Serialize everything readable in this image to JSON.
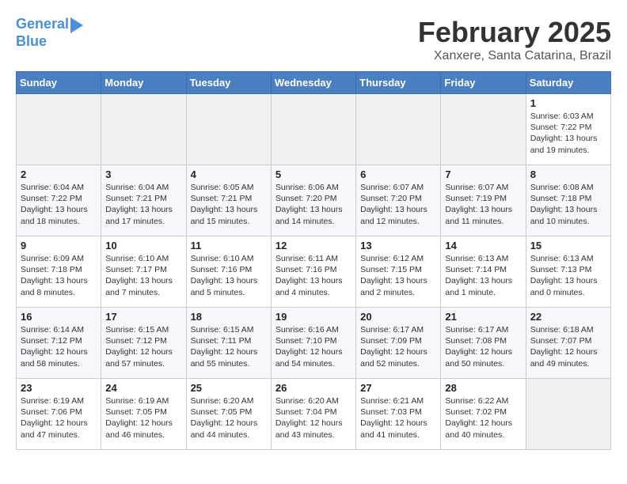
{
  "header": {
    "logo_line1": "General",
    "logo_line2": "Blue",
    "title": "February 2025",
    "subtitle": "Xanxere, Santa Catarina, Brazil"
  },
  "weekdays": [
    "Sunday",
    "Monday",
    "Tuesday",
    "Wednesday",
    "Thursday",
    "Friday",
    "Saturday"
  ],
  "weeks": [
    [
      {
        "day": "",
        "info": ""
      },
      {
        "day": "",
        "info": ""
      },
      {
        "day": "",
        "info": ""
      },
      {
        "day": "",
        "info": ""
      },
      {
        "day": "",
        "info": ""
      },
      {
        "day": "",
        "info": ""
      },
      {
        "day": "1",
        "info": "Sunrise: 6:03 AM\nSunset: 7:22 PM\nDaylight: 13 hours\nand 19 minutes."
      }
    ],
    [
      {
        "day": "2",
        "info": "Sunrise: 6:04 AM\nSunset: 7:22 PM\nDaylight: 13 hours\nand 18 minutes."
      },
      {
        "day": "3",
        "info": "Sunrise: 6:04 AM\nSunset: 7:21 PM\nDaylight: 13 hours\nand 17 minutes."
      },
      {
        "day": "4",
        "info": "Sunrise: 6:05 AM\nSunset: 7:21 PM\nDaylight: 13 hours\nand 15 minutes."
      },
      {
        "day": "5",
        "info": "Sunrise: 6:06 AM\nSunset: 7:20 PM\nDaylight: 13 hours\nand 14 minutes."
      },
      {
        "day": "6",
        "info": "Sunrise: 6:07 AM\nSunset: 7:20 PM\nDaylight: 13 hours\nand 12 minutes."
      },
      {
        "day": "7",
        "info": "Sunrise: 6:07 AM\nSunset: 7:19 PM\nDaylight: 13 hours\nand 11 minutes."
      },
      {
        "day": "8",
        "info": "Sunrise: 6:08 AM\nSunset: 7:18 PM\nDaylight: 13 hours\nand 10 minutes."
      }
    ],
    [
      {
        "day": "9",
        "info": "Sunrise: 6:09 AM\nSunset: 7:18 PM\nDaylight: 13 hours\nand 8 minutes."
      },
      {
        "day": "10",
        "info": "Sunrise: 6:10 AM\nSunset: 7:17 PM\nDaylight: 13 hours\nand 7 minutes."
      },
      {
        "day": "11",
        "info": "Sunrise: 6:10 AM\nSunset: 7:16 PM\nDaylight: 13 hours\nand 5 minutes."
      },
      {
        "day": "12",
        "info": "Sunrise: 6:11 AM\nSunset: 7:16 PM\nDaylight: 13 hours\nand 4 minutes."
      },
      {
        "day": "13",
        "info": "Sunrise: 6:12 AM\nSunset: 7:15 PM\nDaylight: 13 hours\nand 2 minutes."
      },
      {
        "day": "14",
        "info": "Sunrise: 6:13 AM\nSunset: 7:14 PM\nDaylight: 13 hours\nand 1 minute."
      },
      {
        "day": "15",
        "info": "Sunrise: 6:13 AM\nSunset: 7:13 PM\nDaylight: 13 hours\nand 0 minutes."
      }
    ],
    [
      {
        "day": "16",
        "info": "Sunrise: 6:14 AM\nSunset: 7:12 PM\nDaylight: 12 hours\nand 58 minutes."
      },
      {
        "day": "17",
        "info": "Sunrise: 6:15 AM\nSunset: 7:12 PM\nDaylight: 12 hours\nand 57 minutes."
      },
      {
        "day": "18",
        "info": "Sunrise: 6:15 AM\nSunset: 7:11 PM\nDaylight: 12 hours\nand 55 minutes."
      },
      {
        "day": "19",
        "info": "Sunrise: 6:16 AM\nSunset: 7:10 PM\nDaylight: 12 hours\nand 54 minutes."
      },
      {
        "day": "20",
        "info": "Sunrise: 6:17 AM\nSunset: 7:09 PM\nDaylight: 12 hours\nand 52 minutes."
      },
      {
        "day": "21",
        "info": "Sunrise: 6:17 AM\nSunset: 7:08 PM\nDaylight: 12 hours\nand 50 minutes."
      },
      {
        "day": "22",
        "info": "Sunrise: 6:18 AM\nSunset: 7:07 PM\nDaylight: 12 hours\nand 49 minutes."
      }
    ],
    [
      {
        "day": "23",
        "info": "Sunrise: 6:19 AM\nSunset: 7:06 PM\nDaylight: 12 hours\nand 47 minutes."
      },
      {
        "day": "24",
        "info": "Sunrise: 6:19 AM\nSunset: 7:05 PM\nDaylight: 12 hours\nand 46 minutes."
      },
      {
        "day": "25",
        "info": "Sunrise: 6:20 AM\nSunset: 7:05 PM\nDaylight: 12 hours\nand 44 minutes."
      },
      {
        "day": "26",
        "info": "Sunrise: 6:20 AM\nSunset: 7:04 PM\nDaylight: 12 hours\nand 43 minutes."
      },
      {
        "day": "27",
        "info": "Sunrise: 6:21 AM\nSunset: 7:03 PM\nDaylight: 12 hours\nand 41 minutes."
      },
      {
        "day": "28",
        "info": "Sunrise: 6:22 AM\nSunset: 7:02 PM\nDaylight: 12 hours\nand 40 minutes."
      },
      {
        "day": "",
        "info": ""
      }
    ]
  ]
}
